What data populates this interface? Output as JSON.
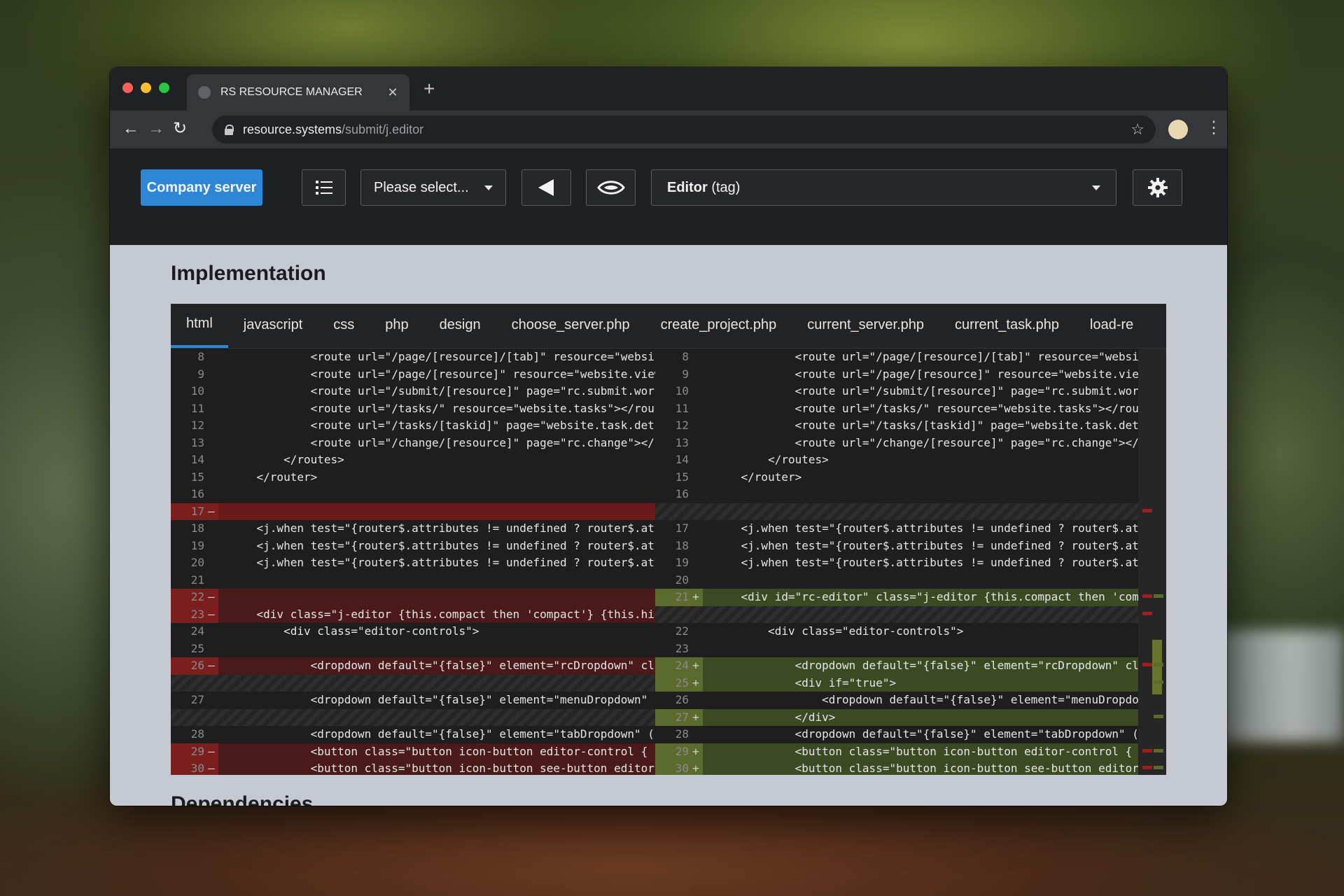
{
  "browser": {
    "tab_title": "RS RESOURCE MANAGER",
    "url_host": "resource.systems",
    "url_path": "/submit/j.editor"
  },
  "toolbar": {
    "server_button": "Company server",
    "page_select": "Please select...",
    "editor_select_bold": "Editor",
    "editor_select_rest": " (tag)"
  },
  "section": {
    "title": "Implementation",
    "next_title": "Dependencies"
  },
  "file_tabs": [
    "html",
    "javascript",
    "css",
    "php",
    "design",
    "choose_server.php",
    "create_project.php",
    "current_server.php",
    "current_task.php",
    "load-re"
  ],
  "active_tab": 0,
  "diff": {
    "left": [
      {
        "n": "8",
        "t": "",
        "c": "            <route url=\"/page/[resource]/[tab]\" resource=\"website"
      },
      {
        "n": "9",
        "t": "",
        "c": "            <route url=\"/page/[resource]\" resource=\"website.view"
      },
      {
        "n": "10",
        "t": "",
        "c": "            <route url=\"/submit/[resource]\" page=\"rc.submit.work"
      },
      {
        "n": "11",
        "t": "",
        "c": "            <route url=\"/tasks/\" resource=\"website.tasks\"></rout"
      },
      {
        "n": "12",
        "t": "",
        "c": "            <route url=\"/tasks/[taskid]\" page=\"website.task.deta"
      },
      {
        "n": "13",
        "t": "",
        "c": "            <route url=\"/change/[resource]\" page=\"rc.change\"></r"
      },
      {
        "n": "14",
        "t": "",
        "c": "        </routes>"
      },
      {
        "n": "15",
        "t": "",
        "c": "    </router>"
      },
      {
        "n": "16",
        "t": "",
        "c": ""
      },
      {
        "n": "17",
        "t": "del-strong",
        "m": "–",
        "c": ""
      },
      {
        "n": "18",
        "t": "",
        "c": "    <j.when test=\"{router$.attributes != undefined ? router$.att"
      },
      {
        "n": "19",
        "t": "",
        "c": "    <j.when test=\"{router$.attributes != undefined ? router$.att"
      },
      {
        "n": "20",
        "t": "",
        "c": "    <j.when test=\"{router$.attributes != undefined ? router$.att"
      },
      {
        "n": "21",
        "t": "",
        "c": ""
      },
      {
        "n": "22",
        "t": "del",
        "m": "–",
        "c": ""
      },
      {
        "n": "23",
        "t": "del",
        "m": "–",
        "c": "    <div class=\"j-editor {this.compact then 'compact'} {this.hid"
      },
      {
        "n": "24",
        "t": "",
        "c": "        <div class=\"editor-controls\">"
      },
      {
        "n": "25",
        "t": "",
        "c": ""
      },
      {
        "n": "26",
        "t": "del",
        "m": "–",
        "c": "            <dropdown default=\"{false}\" element=\"rcDropdown\" cla"
      },
      {
        "n": "",
        "t": "empty",
        "c": ""
      },
      {
        "n": "27",
        "t": "",
        "c": "            <dropdown default=\"{false}\" element=\"menuDropdown\" c"
      },
      {
        "n": "",
        "t": "empty",
        "c": ""
      },
      {
        "n": "28",
        "t": "",
        "c": "            <dropdown default=\"{false}\" element=\"tabDropdown\" (c"
      },
      {
        "n": "29",
        "t": "del",
        "m": "–",
        "c": "            <button class=\"button icon-button editor-control { ("
      },
      {
        "n": "30",
        "t": "del",
        "m": "–",
        "c": "            <button class=\"button icon-button see-button editor-"
      }
    ],
    "right": [
      {
        "n": "8",
        "t": "",
        "c": "            <route url=\"/page/[resource]/[tab]\" resource=\"websit"
      },
      {
        "n": "9",
        "t": "",
        "c": "            <route url=\"/page/[resource]\" resource=\"website.view"
      },
      {
        "n": "10",
        "t": "",
        "c": "            <route url=\"/submit/[resource]\" page=\"rc.submit.work"
      },
      {
        "n": "11",
        "t": "",
        "c": "            <route url=\"/tasks/\" resource=\"website.tasks\"></rout"
      },
      {
        "n": "12",
        "t": "",
        "c": "            <route url=\"/tasks/[taskid]\" page=\"website.task.deta"
      },
      {
        "n": "13",
        "t": "",
        "c": "            <route url=\"/change/[resource]\" page=\"rc.change\"></r"
      },
      {
        "n": "14",
        "t": "",
        "c": "        </routes>"
      },
      {
        "n": "15",
        "t": "",
        "c": "    </router>"
      },
      {
        "n": "16",
        "t": "",
        "c": ""
      },
      {
        "n": "",
        "t": "empty",
        "c": ""
      },
      {
        "n": "17",
        "t": "",
        "c": "    <j.when test=\"{router$.attributes != undefined ? router$.att"
      },
      {
        "n": "18",
        "t": "",
        "c": "    <j.when test=\"{router$.attributes != undefined ? router$.att"
      },
      {
        "n": "19",
        "t": "",
        "c": "    <j.when test=\"{router$.attributes != undefined ? router$.att"
      },
      {
        "n": "20",
        "t": "",
        "c": ""
      },
      {
        "n": "21",
        "t": "add",
        "m": "+",
        "c": "    <div id=\"rc-editor\" class=\"j-editor {this.compact then 'comp"
      },
      {
        "n": "",
        "t": "empty",
        "c": ""
      },
      {
        "n": "22",
        "t": "",
        "c": "        <div class=\"editor-controls\">"
      },
      {
        "n": "23",
        "t": "",
        "c": ""
      },
      {
        "n": "24",
        "t": "add",
        "m": "+",
        "c": "            <dropdown default=\"{false}\" element=\"rcDropdown\" cla"
      },
      {
        "n": "25",
        "t": "add",
        "m": "+",
        "c": "            <div if=\"true\">"
      },
      {
        "n": "26",
        "t": "",
        "c": "                <dropdown default=\"{false}\" element=\"menuDropdow"
      },
      {
        "n": "27",
        "t": "add",
        "m": "+",
        "c": "            </div>"
      },
      {
        "n": "28",
        "t": "",
        "c": "            <dropdown default=\"{false}\" element=\"tabDropdown\" (c"
      },
      {
        "n": "29",
        "t": "add",
        "m": "+",
        "c": "            <button class=\"button icon-button editor-control { ("
      },
      {
        "n": "30",
        "t": "add",
        "m": "+",
        "c": "            <button class=\"button icon-button see-button editor-"
      }
    ]
  },
  "colors": {
    "accent": "#2e86d6",
    "deletion": "#6b1a1a",
    "addition": "#3c4a23"
  },
  "icons": {
    "list_button": "list-icon",
    "back_button": "triangle-left-icon",
    "preview_button": "eye-icon",
    "settings_button": "gear-icon"
  }
}
